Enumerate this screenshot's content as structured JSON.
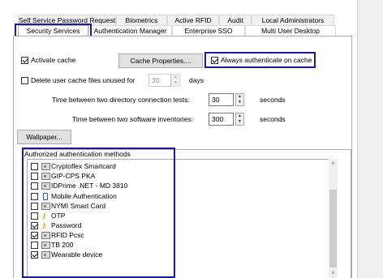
{
  "tabs_back": [
    {
      "label": "Self Service Password Request"
    },
    {
      "label": "Biometrics"
    },
    {
      "label": "Active RFID"
    },
    {
      "label": "Audit"
    },
    {
      "label": "Local Administrators"
    }
  ],
  "tabs_front": [
    {
      "label": "Security Services",
      "active": true
    },
    {
      "label": "Authentication Manager"
    },
    {
      "label": "Enterprise SSO"
    },
    {
      "label": "Multi User Desktop"
    }
  ],
  "cache": {
    "activate_label": "Activate cache",
    "activate_checked": true,
    "properties_button": "Cache Properties....",
    "always_auth_label": "Always authenticate on cache",
    "always_auth_checked": true
  },
  "delete_files": {
    "label": "Delete user cache files unused for",
    "checked": false,
    "value": "30",
    "unit": "days"
  },
  "directory_test": {
    "label": "Time between two directory connection tests:",
    "value": "30",
    "unit": "seconds"
  },
  "software_inventory": {
    "label": "Time between two software inventories:",
    "value": "300",
    "unit": "seconds"
  },
  "wallpaper_button": "Wallpaper...",
  "auth_methods": {
    "title": "Authorized authentication methods",
    "items": [
      {
        "label": "Cryptoflex Smartcard",
        "checked": false,
        "icon": "smartcard-icon"
      },
      {
        "label": "GIP-CPS PKA",
        "checked": false,
        "icon": "smartcard-icon"
      },
      {
        "label": "IDPrime .NET - MD 3810",
        "checked": false,
        "icon": "smartcard-icon"
      },
      {
        "label": "Mobile Authentication",
        "checked": false,
        "icon": "phone-icon"
      },
      {
        "label": "NYMI Smart Card",
        "checked": false,
        "icon": "smartcard-icon"
      },
      {
        "label": "OTP",
        "checked": false,
        "icon": "key-icon"
      },
      {
        "label": "Password",
        "checked": true,
        "icon": "key-icon"
      },
      {
        "label": "RFID Pcsc",
        "checked": true,
        "icon": "smartcard-icon"
      },
      {
        "label": "TB 200",
        "checked": false,
        "icon": "smartcard-icon"
      },
      {
        "label": "Wearable device",
        "checked": true,
        "icon": "smartcard-icon"
      }
    ]
  },
  "colors": {
    "highlight": "#1a1aa8",
    "accent": "#1e5fd6",
    "key": "#d4a014"
  }
}
